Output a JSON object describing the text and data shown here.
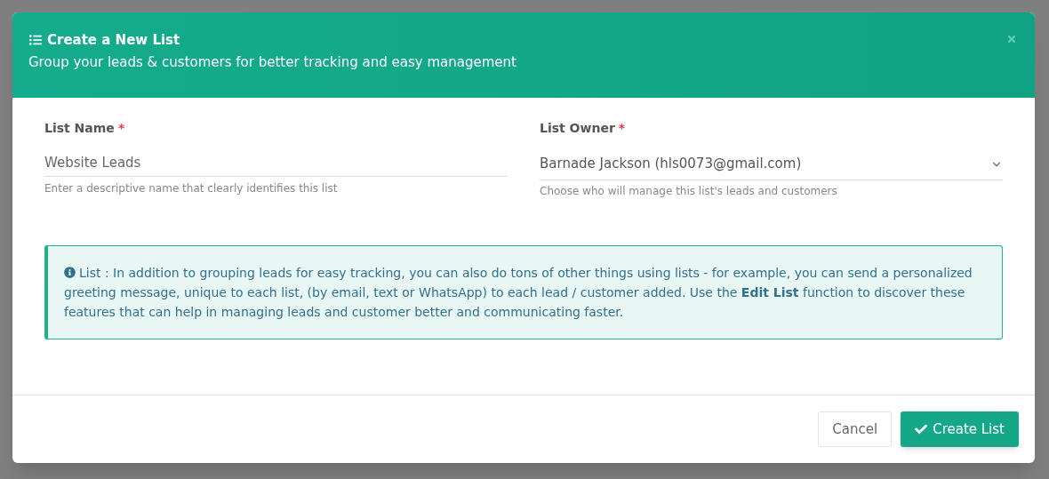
{
  "modal": {
    "title": "Create a New List",
    "subtitle": "Group your leads & customers for better tracking and easy management"
  },
  "fields": [
    {
      "kind": "text",
      "label": "List Name",
      "required_mark": "*",
      "value": "Website Leads",
      "help": "Enter a descriptive name that clearly identifies this list"
    },
    {
      "kind": "select",
      "label": "List Owner",
      "required_mark": "*",
      "value": "Barnade Jackson (hls0073@gmail.com)",
      "help": "Choose who will manage this list's leads and customers"
    }
  ],
  "info": "List : In addition to grouping leads for easy tracking, you can also do tons of other things using lists - for example, you can send a personalized greeting message, unique to each list, (by email, text or WhatsApp) to each lead / customer added. Use the **Edit List** function to discover these features that can help in managing leads and customer better and communicating faster.",
  "buttons": [
    {
      "kind": "secondary",
      "label": "Cancel"
    },
    {
      "kind": "primary",
      "label": "Create List"
    }
  ]
}
